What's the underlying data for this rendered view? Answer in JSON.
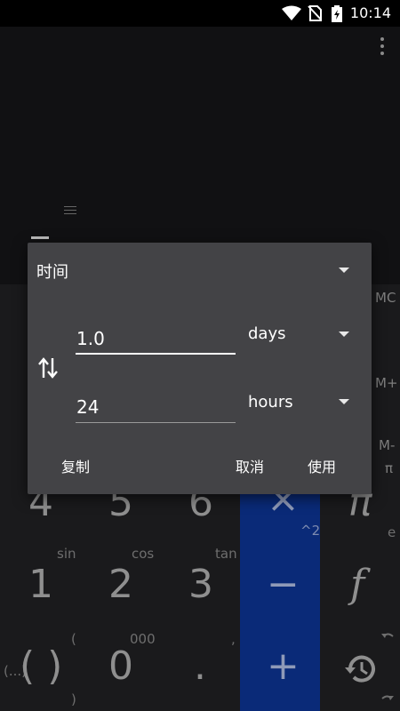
{
  "status": {
    "time": "10:14"
  },
  "dialog": {
    "category": "时间",
    "fields": [
      {
        "value": "1.0",
        "unit": "days"
      },
      {
        "value": "24",
        "unit": "hours"
      }
    ],
    "buttons": {
      "copy": "复制",
      "cancel": "取消",
      "use": "使用"
    }
  },
  "keypad": {
    "memory": {
      "mc": "MC",
      "mplus": "M+",
      "mminus": "M-",
      "pi": "π"
    },
    "row1": {
      "k4": "4",
      "k5": "5",
      "k6": "6",
      "mul": "×",
      "pi_key": "π",
      "pow": "^2",
      "e": "e"
    },
    "row2_labels": {
      "sin": "sin",
      "cos": "cos",
      "tan": "tan"
    },
    "row2": {
      "k1": "1",
      "k2": "2",
      "k3": "3",
      "minus": "−",
      "func": "f"
    },
    "row3_labels": {
      "open": "(",
      "thousand": "000",
      "comma": ",",
      "close": ")",
      "ellipsis": "(...)"
    },
    "row3": {
      "parens": "( )",
      "k0": "0",
      "dot": ".",
      "plus": "+"
    }
  },
  "colors": {
    "operator_column": "#0a2a78",
    "dialog_bg": "#434346"
  },
  "icons": [
    "wifi-icon",
    "no-sim-icon",
    "battery-charging-icon",
    "overflow-menu-icon",
    "swap-icon",
    "dropdown-caret-icon",
    "history-icon",
    "undo-icon",
    "redo-icon"
  ]
}
